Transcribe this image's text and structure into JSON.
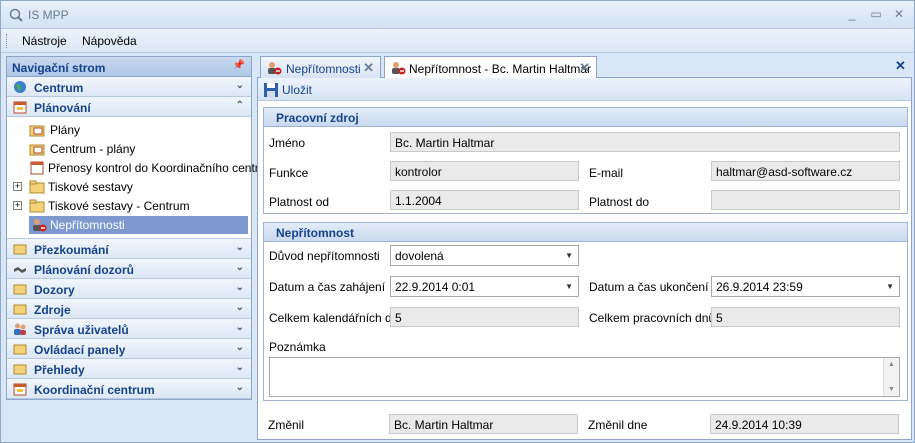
{
  "window": {
    "title": "IS MPP"
  },
  "menu": {
    "items": [
      "Nástroje",
      "Nápověda"
    ]
  },
  "nav": {
    "header": "Navigační strom",
    "groups_top": [
      {
        "label": "Centrum",
        "icon": "globe-icon"
      },
      {
        "label": "Plánování",
        "icon": "calendar-icon"
      }
    ],
    "tree": [
      {
        "label": "Plány",
        "icon": "folder-calendar-icon"
      },
      {
        "label": "Centrum - plány",
        "icon": "folder-calendar-icon"
      },
      {
        "label": "Přenosy kontrol do Koordinačního centra",
        "icon": "calendar-icon"
      },
      {
        "label": "Tiskové sestavy",
        "icon": "folder-icon"
      },
      {
        "label": "Tiskové sestavy - Centrum",
        "icon": "folder-icon"
      },
      {
        "label": "Nepřítomnosti",
        "icon": "person-absent-icon"
      }
    ],
    "groups_bottom": [
      {
        "label": "Přezkoumání",
        "icon": "folder-icon"
      },
      {
        "label": "Plánování dozorů",
        "icon": "handshake-icon"
      },
      {
        "label": "Dozory",
        "icon": "folder-icon"
      },
      {
        "label": "Zdroje",
        "icon": "folder-icon"
      },
      {
        "label": "Správa uživatelů",
        "icon": "users-icon"
      },
      {
        "label": "Ovládací panely",
        "icon": "folder-icon"
      },
      {
        "label": "Přehledy",
        "icon": "folder-icon"
      },
      {
        "label": "Koordinační centrum",
        "icon": "calendar-icon"
      }
    ]
  },
  "tabs": [
    {
      "label": "Nepřítomnosti"
    },
    {
      "label": "Nepřítomnost - Bc. Martin Haltmar"
    }
  ],
  "toolbar": {
    "save_label": "Uložit"
  },
  "resource": {
    "header": "Pracovní zdroj",
    "name_label": "Jméno",
    "name_value": "Bc. Martin Haltmar",
    "function_label": "Funkce",
    "function_value": "kontrolor",
    "email_label": "E-mail",
    "email_value": "haltmar@asd-software.cz",
    "valid_from_label": "Platnost od",
    "valid_from_value": "1.1.2004",
    "valid_to_label": "Platnost do",
    "valid_to_value": ""
  },
  "absence": {
    "header": "Nepřítomnost",
    "reason_label": "Důvod nepřítomnosti",
    "reason_value": "dovolená",
    "start_label": "Datum a čas zahájení",
    "start_value": "22.9.2014 0:01",
    "end_label": "Datum a čas ukončení",
    "end_value": "26.9.2014 23:59",
    "cal_days_label": "Celkem kalendářních dnů",
    "cal_days_value": "5",
    "work_days_label": "Celkem pracovních dnů",
    "work_days_value": "5",
    "note_label": "Poznámka"
  },
  "footer": {
    "changed_by_label": "Změnil",
    "changed_by_value": "Bc. Martin Haltmar",
    "changed_on_label": "Změnil dne",
    "changed_on_value": "24.9.2014 10:39"
  }
}
